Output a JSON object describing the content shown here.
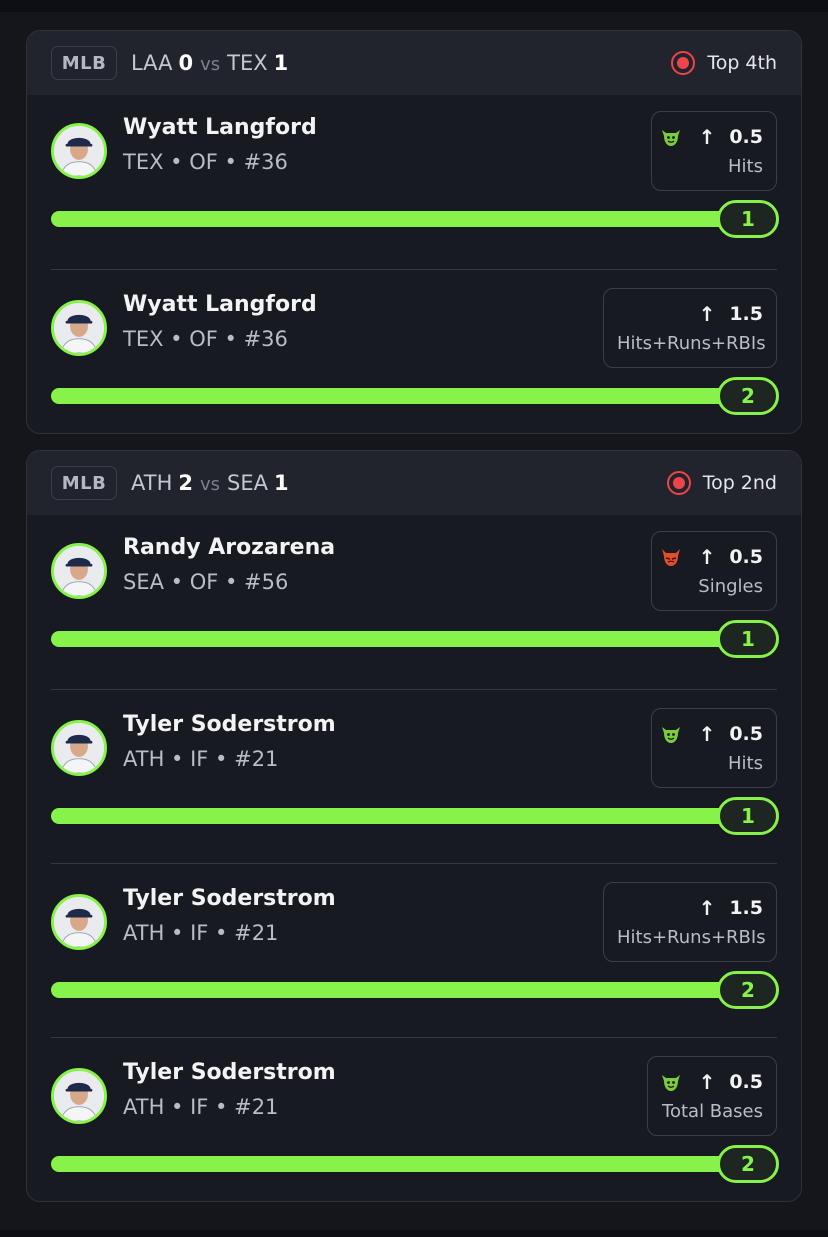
{
  "colors": {
    "accent": "#86f24a",
    "live": "#f0434a",
    "background": "#14161c",
    "card": "#171a21"
  },
  "games": [
    {
      "league": "MLB",
      "away_team": "LAA",
      "away_score": "0",
      "vs": "vs",
      "home_team": "TEX",
      "home_score": "1",
      "status": "Top 4th",
      "picks": [
        {
          "player": "Wyatt Langford",
          "meta": "TEX • OF • #36",
          "icon": "goblin-icon",
          "direction": "↑",
          "line": "0.5",
          "stat": "Hits",
          "current": "1",
          "progress": 1.0
        },
        {
          "player": "Wyatt Langford",
          "meta": "TEX • OF • #36",
          "icon": "",
          "direction": "↑",
          "line": "1.5",
          "stat": "Hits+Runs+RBIs",
          "current": "2",
          "progress": 1.0
        }
      ]
    },
    {
      "league": "MLB",
      "away_team": "ATH",
      "away_score": "2",
      "vs": "vs",
      "home_team": "SEA",
      "home_score": "1",
      "status": "Top 2nd",
      "picks": [
        {
          "player": "Randy Arozarena",
          "meta": "SEA • OF • #56",
          "icon": "demon-icon",
          "direction": "↑",
          "line": "0.5",
          "stat": "Singles",
          "current": "1",
          "progress": 1.0
        },
        {
          "player": "Tyler Soderstrom",
          "meta": "ATH • IF • #21",
          "icon": "goblin-icon",
          "direction": "↑",
          "line": "0.5",
          "stat": "Hits",
          "current": "1",
          "progress": 1.0
        },
        {
          "player": "Tyler Soderstrom",
          "meta": "ATH • IF • #21",
          "icon": "",
          "direction": "↑",
          "line": "1.5",
          "stat": "Hits+Runs+RBIs",
          "current": "2",
          "progress": 1.0
        },
        {
          "player": "Tyler Soderstrom",
          "meta": "ATH • IF • #21",
          "icon": "goblin-icon",
          "direction": "↑",
          "line": "0.5",
          "stat": "Total Bases",
          "current": "2",
          "progress": 1.0
        }
      ]
    }
  ]
}
